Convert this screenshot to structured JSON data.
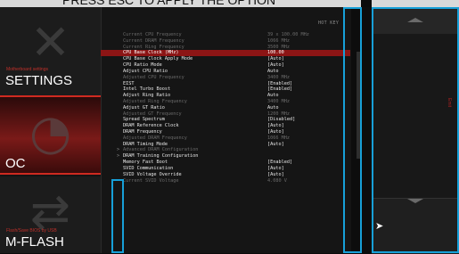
{
  "window": {
    "top_caption": "PRESS ESC TO APPLY THE OPTION"
  },
  "sidebar": {
    "settings": {
      "subtitle": "Motherboard settings",
      "title": "SETTINGS"
    },
    "oc": {
      "title": "OC"
    },
    "mflash": {
      "subtitle": "Flash/Save BIOS by USB",
      "title": "M-FLASH"
    }
  },
  "header": {
    "hotkey": "HOT KEY",
    "back_glyph": "↺"
  },
  "panel": {
    "rows": [
      {
        "label": "Current CPU Frequency",
        "value": "39 x 100.00 MHz",
        "state": "dim"
      },
      {
        "label": "Current DRAM Frequency",
        "value": "1066 MHz",
        "state": "dim"
      },
      {
        "label": "Current Ring Frequency",
        "value": "3500 MHz",
        "state": "dim"
      },
      {
        "label": "CPU Base Clock (MHz)",
        "value": "100.00",
        "state": "sel"
      },
      {
        "label": "CPU Base Clock Apply Mode",
        "value": "[Auto]",
        "state": ""
      },
      {
        "label": "CPU Ratio Mode",
        "value": "[Auto]",
        "state": ""
      },
      {
        "label": "Adjust CPU Ratio",
        "value": "Auto",
        "state": ""
      },
      {
        "label": "Adjusted CPU Frequency",
        "value": "3400 MHz",
        "state": "dim"
      },
      {
        "label": "EIST",
        "value": "[Enabled]",
        "state": ""
      },
      {
        "label": "Intel Turbo Boost",
        "value": "[Enabled]",
        "state": ""
      },
      {
        "label": "Adjust Ring Ratio",
        "value": "Auto",
        "state": ""
      },
      {
        "label": "Adjusted Ring Frequency",
        "value": "3400 MHz",
        "state": "dim"
      },
      {
        "label": "Adjust GT Ratio",
        "value": "Auto",
        "state": ""
      },
      {
        "label": "Adjusted GT Frequency",
        "value": "1200 MHz",
        "state": "dim"
      },
      {
        "label": "Spread Spectrum",
        "value": "[Disabled]",
        "state": ""
      },
      {
        "label": "DRAM Reference Clock",
        "value": "[Auto]",
        "state": ""
      },
      {
        "label": "DRAM Frequency",
        "value": "[Auto]",
        "state": ""
      },
      {
        "label": "Adjusted DRAM Frequency",
        "value": "1066 MHz",
        "state": "dim"
      },
      {
        "label": "DRAM Timing Mode",
        "value": "[Auto]",
        "state": ""
      },
      {
        "label": "Advanced DRAM Configuration",
        "value": "",
        "state": "dim",
        "arrow": ">"
      },
      {
        "label": "DRAM Training Configuration",
        "value": "",
        "state": "",
        "arrow": ">"
      },
      {
        "label": "Memory Fast Boot",
        "value": "[Enabled]",
        "state": ""
      },
      {
        "label": "SVID Communication",
        "value": "[Auto]",
        "state": ""
      },
      {
        "label": "SVID Voltage Override",
        "value": "[Auto]",
        "state": ""
      },
      {
        "label": "Current SVID Voltage",
        "value": "4.080 V",
        "state": "dim"
      }
    ]
  },
  "right_panel": {
    "label": "Emit"
  },
  "colors": {
    "accent": "#d02a20",
    "highlight": "#17a0d8"
  }
}
